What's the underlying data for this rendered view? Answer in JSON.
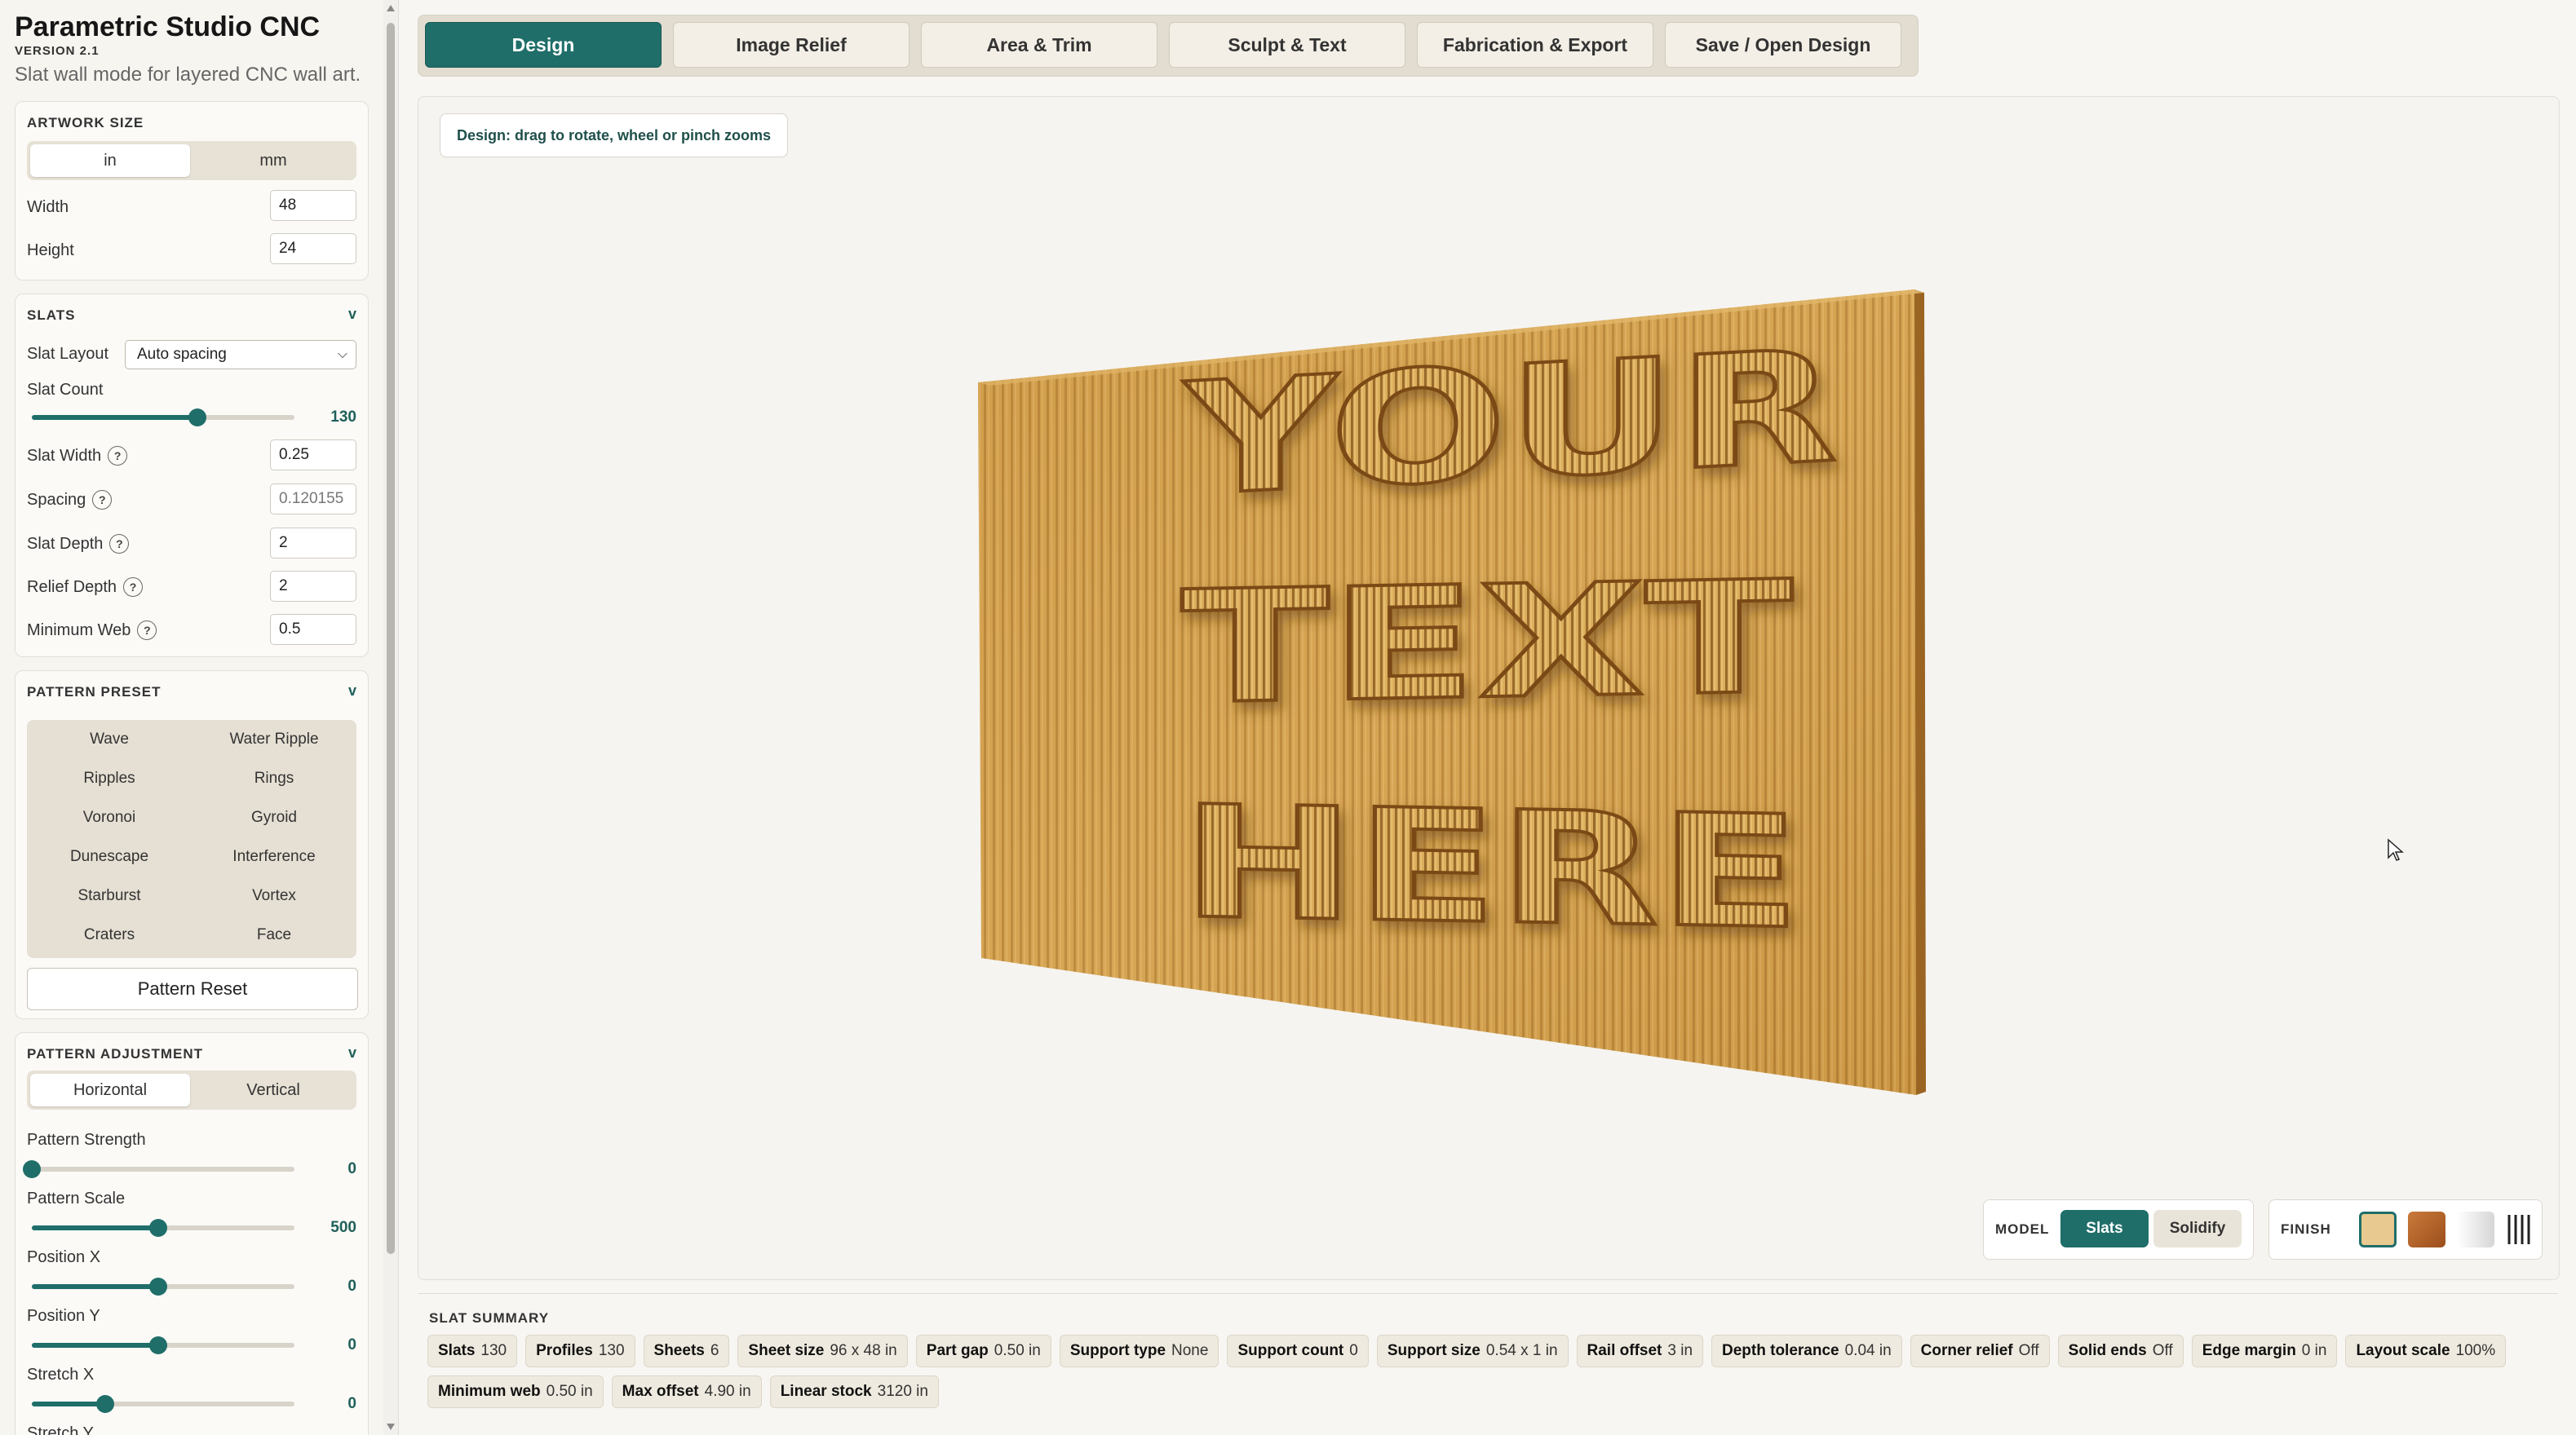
{
  "app": {
    "title": "Parametric Studio CNC",
    "version": "VERSION 2.1",
    "subtitle": "Slat wall mode for layered CNC wall art."
  },
  "tabs": [
    "Design",
    "Image Relief",
    "Area & Trim",
    "Sculpt & Text",
    "Fabrication & Export",
    "Save / Open Design"
  ],
  "active_tab": "Design",
  "artwork": {
    "title": "ARTWORK SIZE",
    "units": [
      "in",
      "mm"
    ],
    "active_unit": "in",
    "width_label": "Width",
    "width": "48",
    "height_label": "Height",
    "height": "24"
  },
  "slats": {
    "title": "SLATS",
    "chev": "v",
    "layout_label": "Slat Layout",
    "layout_value": "Auto spacing",
    "count_label": "Slat Count",
    "count_value": "130",
    "count_fraction": 0.63,
    "width_label": "Slat Width",
    "width": "0.25",
    "spacing_label": "Spacing",
    "spacing": "0.120155",
    "depth_label": "Slat Depth",
    "depth": "2",
    "relief_label": "Relief Depth",
    "relief": "2",
    "web_label": "Minimum Web",
    "web": "0.5",
    "help": "?"
  },
  "preset": {
    "title": "PATTERN PRESET",
    "chev": "v",
    "items": [
      "Wave",
      "Water Ripple",
      "Ripples",
      "Rings",
      "Voronoi",
      "Gyroid",
      "Dunescape",
      "Interference",
      "Starburst",
      "Vortex",
      "Craters",
      "Face"
    ],
    "reset_label": "Pattern Reset"
  },
  "adjust": {
    "title": "PATTERN ADJUSTMENT",
    "chev": "v",
    "orient": [
      "Horizontal",
      "Vertical"
    ],
    "active_orient": "Horizontal",
    "sliders": [
      {
        "label": "Pattern Strength",
        "value": "0",
        "fraction": 0.0
      },
      {
        "label": "Pattern Scale",
        "value": "500",
        "fraction": 0.48
      },
      {
        "label": "Position X",
        "value": "0",
        "fraction": 0.48
      },
      {
        "label": "Position Y",
        "value": "0",
        "fraction": 0.48
      },
      {
        "label": "Stretch X",
        "value": "0",
        "fraction": 0.28
      }
    ],
    "more_label": "Stretch Y"
  },
  "viewport": {
    "hint": "Design: drag to rotate, wheel or pinch zooms",
    "art_text": [
      "YOUR",
      "TEXT",
      "HERE"
    ],
    "model_label": "MODEL",
    "model_options": [
      "Slats",
      "Solidify"
    ],
    "active_model": "Slats",
    "finish_label": "FINISH",
    "finish_swatches": [
      "#e8c98f",
      "#c06a2e",
      "#f0f0f0",
      "lines-icon"
    ]
  },
  "summary": {
    "title": "SLAT SUMMARY",
    "chips": [
      {
        "k": "Slats",
        "v": "130"
      },
      {
        "k": "Profiles",
        "v": "130"
      },
      {
        "k": "Sheets",
        "v": "6"
      },
      {
        "k": "Sheet size",
        "v": "96 x 48 in"
      },
      {
        "k": "Part gap",
        "v": "0.50 in"
      },
      {
        "k": "Support type",
        "v": "None"
      },
      {
        "k": "Support count",
        "v": "0"
      },
      {
        "k": "Support size",
        "v": "0.54 x 1 in"
      },
      {
        "k": "Rail offset",
        "v": "3 in"
      },
      {
        "k": "Depth tolerance",
        "v": "0.04 in"
      },
      {
        "k": "Corner relief",
        "v": "Off"
      },
      {
        "k": "Solid ends",
        "v": "Off"
      },
      {
        "k": "Edge margin",
        "v": "0 in"
      },
      {
        "k": "Layout scale",
        "v": "100%"
      },
      {
        "k": "Minimum web",
        "v": "0.50 in"
      },
      {
        "k": "Max offset",
        "v": "4.90 in"
      },
      {
        "k": "Linear stock",
        "v": "3120 in"
      }
    ]
  },
  "colors": {
    "accent": "#1f6e69",
    "wood": "#d9a85a"
  }
}
